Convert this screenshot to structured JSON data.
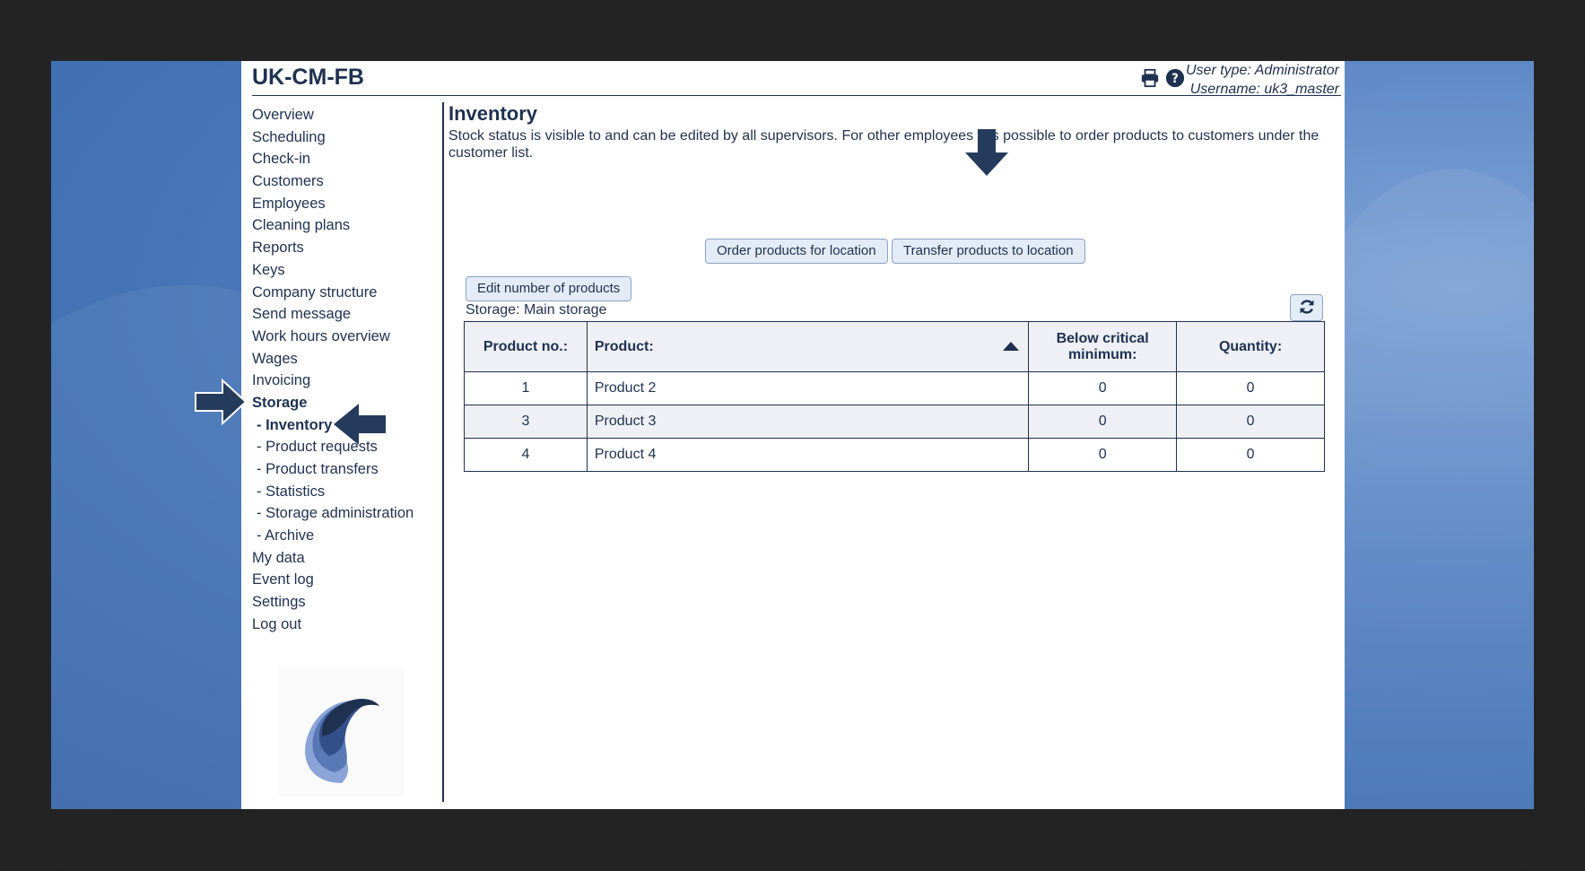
{
  "app": {
    "title": "UK-CM-FB",
    "user_type": "User type: Administrator",
    "username": "Username: uk3_master"
  },
  "header_icons": [
    "printer-icon",
    "help-icon"
  ],
  "sidebar": {
    "items": [
      {
        "label": "Overview"
      },
      {
        "label": "Scheduling"
      },
      {
        "label": "Check-in"
      },
      {
        "label": "Customers"
      },
      {
        "label": "Employees"
      },
      {
        "label": "Cleaning plans"
      },
      {
        "label": "Reports"
      },
      {
        "label": "Keys"
      },
      {
        "label": "Company structure"
      },
      {
        "label": "Send message"
      },
      {
        "label": "Work hours overview"
      },
      {
        "label": "Wages"
      },
      {
        "label": "Invoicing"
      },
      {
        "label": "Storage"
      },
      {
        "label": "- Inventory"
      },
      {
        "label": "- Product requests"
      },
      {
        "label": "- Product transfers"
      },
      {
        "label": "- Statistics"
      },
      {
        "label": "- Storage administration"
      },
      {
        "label": "- Archive"
      },
      {
        "label": "My data"
      },
      {
        "label": "Event log"
      },
      {
        "label": "Settings"
      },
      {
        "label": "Log out"
      }
    ]
  },
  "main": {
    "title": "Inventory",
    "description": "Stock status is visible to and can be edited by all supervisors. For other employees it is possible to order products to customers under the customer list.",
    "buttons": {
      "order": "Order products for location",
      "transfer": "Transfer products to location",
      "edit": "Edit number of products"
    },
    "storage_label": "Storage:",
    "storage_value": "Main storage",
    "table": {
      "headers": [
        "Product no.:",
        "Product:",
        "Below critical minimum:",
        "Quantity:"
      ],
      "rows": [
        [
          "1",
          "Product 2",
          "0",
          "0"
        ],
        [
          "3",
          "Product 3",
          "0",
          "0"
        ],
        [
          "4",
          "Product 4",
          "0",
          "0"
        ]
      ]
    }
  },
  "colors": {
    "brand_navy": "#1f3150",
    "button_bg": "#e3ebf6",
    "desktop_blue": "#4a78ba",
    "annotation_arrow": "#253b5c"
  }
}
